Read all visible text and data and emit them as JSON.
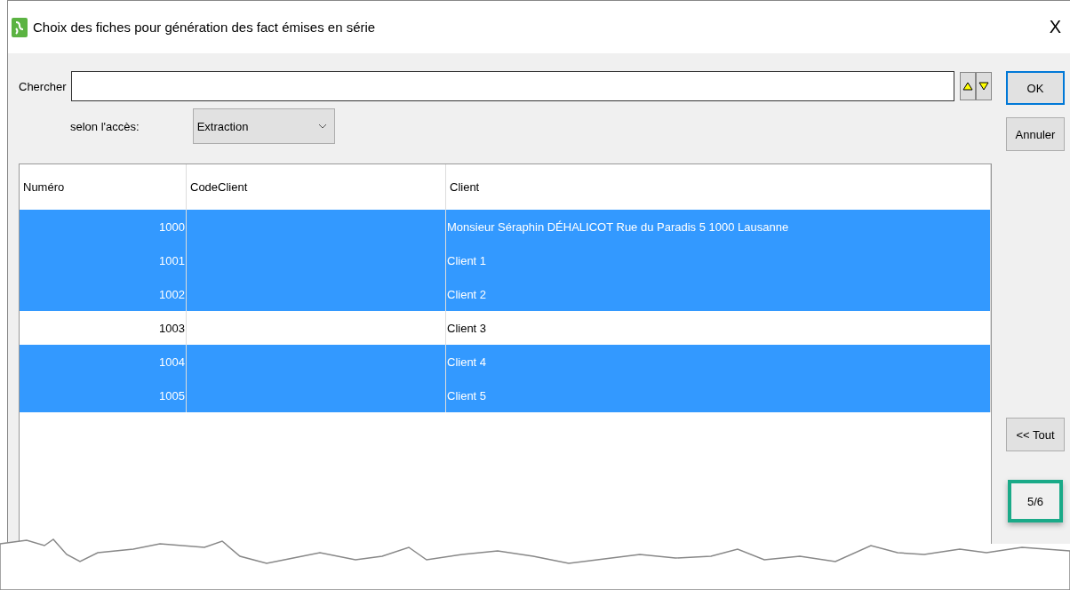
{
  "window": {
    "title": "Choix des fiches pour génération des fact émises en série",
    "close": "X"
  },
  "search": {
    "label": "Chercher"
  },
  "access": {
    "label": "selon l'accès:",
    "value": "Extraction"
  },
  "table": {
    "columns": [
      "Numéro",
      "CodeClient",
      "Client"
    ],
    "rows": [
      {
        "numero": "1000",
        "client": "Monsieur Séraphin DÉHALICOT Rue du Paradis 5 1000 Lausanne",
        "selected": true
      },
      {
        "numero": "1001",
        "client": "Client 1",
        "selected": true
      },
      {
        "numero": "1002",
        "client": "Client 2",
        "selected": true
      },
      {
        "numero": "1003",
        "client": "Client 3",
        "selected": false
      },
      {
        "numero": "1004",
        "client": "Client 4",
        "selected": true
      },
      {
        "numero": "1005",
        "client": "Client 5",
        "selected": true
      }
    ]
  },
  "buttons": {
    "ok": "OK",
    "cancel": "Annuler",
    "all": "<< Tout"
  },
  "count": "5/6"
}
